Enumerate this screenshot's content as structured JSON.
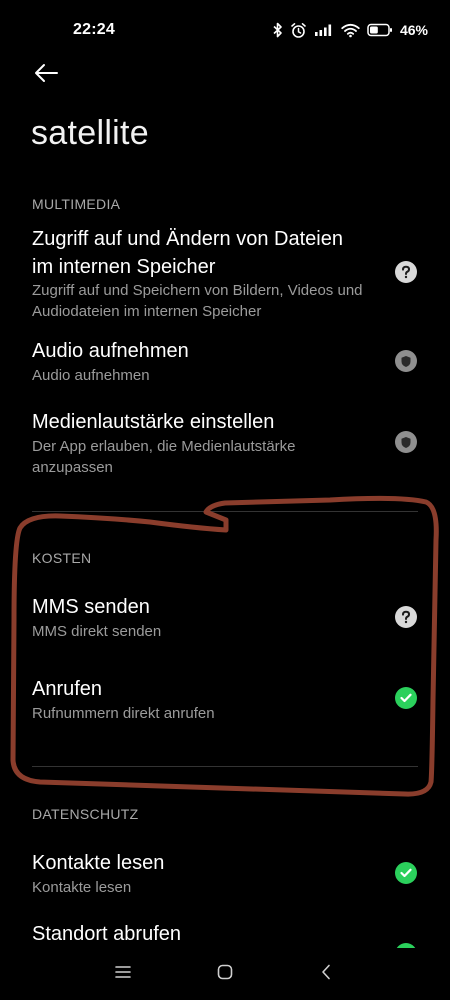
{
  "status_bar": {
    "time": "22:24",
    "battery_percent": "46%",
    "battery_level": 0.46,
    "icons": [
      "bluetooth-icon",
      "alarm-icon",
      "signal-icon",
      "wifi-icon",
      "battery-icon"
    ]
  },
  "header": {
    "back_icon": "arrow-left-icon",
    "title": "satellite"
  },
  "sections": {
    "multimedia": {
      "header": "MULTIMEDIA",
      "items": [
        {
          "title_line1": "Zugriff auf und Ändern von Dateien",
          "title_line2": "im internen Speicher",
          "subtitle_line1": "Zugriff auf und Speichern von Bildern, Videos und",
          "subtitle_line2": "Audiodateien im internen Speicher",
          "status": "ask"
        },
        {
          "title": "Audio aufnehmen",
          "subtitle": "Audio aufnehmen",
          "status": "shield"
        },
        {
          "title": "Medienlautstärke einstellen",
          "subtitle_line1": "Der App erlauben, die Medienlautstärke",
          "subtitle_line2": "anzupassen",
          "status": "shield"
        }
      ]
    },
    "kosten": {
      "header": "KOSTEN",
      "items": [
        {
          "title": "MMS senden",
          "subtitle": "MMS direkt senden",
          "status": "ask"
        },
        {
          "title": "Anrufen",
          "subtitle": "Rufnummern direkt anrufen",
          "status": "allowed"
        }
      ]
    },
    "datenschutz": {
      "header": "DATENSCHUTZ",
      "items": [
        {
          "title": "Kontakte lesen",
          "subtitle": "Kontakte lesen",
          "status": "allowed"
        },
        {
          "title": "Standort abrufen",
          "status": "allowed"
        }
      ]
    }
  },
  "colors": {
    "background": "#000000",
    "allowed": "#2bd05c",
    "ask": "#d9d9d9",
    "shield": "#8f8f8f",
    "annotation": "#8a3d2c"
  },
  "nav": {
    "menu_icon": "menu-icon",
    "home_icon": "home-icon",
    "back_icon": "back-chevron-icon"
  }
}
